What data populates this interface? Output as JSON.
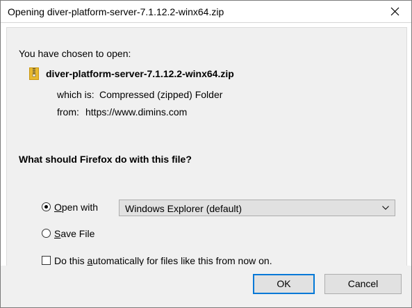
{
  "window": {
    "title": "Opening diver-platform-server-7.1.12.2-winx64.zip",
    "close_icon": "close-icon"
  },
  "file": {
    "chosen_label": "You have chosen to open:",
    "icon": "zip-file-icon",
    "name": "diver-platform-server-7.1.12.2-winx64.zip",
    "which_is_label": "which is:",
    "which_is_value": "Compressed (zipped) Folder",
    "from_label": "from:",
    "from_value": "https://www.dimins.com"
  },
  "action": {
    "question": "What should Firefox do with this file?",
    "open_with_label_pre": "",
    "open_with_label_accel": "O",
    "open_with_label_post": "pen with",
    "open_with_selected": true,
    "open_with_app": "Windows Explorer (default)",
    "save_file_label_accel": "S",
    "save_file_label_post": "ave File",
    "save_file_selected": false,
    "auto_label_pre": "Do this ",
    "auto_label_accel": "a",
    "auto_label_post": "utomatically for files like this from now on.",
    "auto_checked": false
  },
  "buttons": {
    "ok_label": "OK",
    "cancel_label": "Cancel"
  },
  "colors": {
    "accent": "#0078d7",
    "dialog_bg": "#f0f0f0",
    "zip_yellow": "#e8b92e"
  }
}
